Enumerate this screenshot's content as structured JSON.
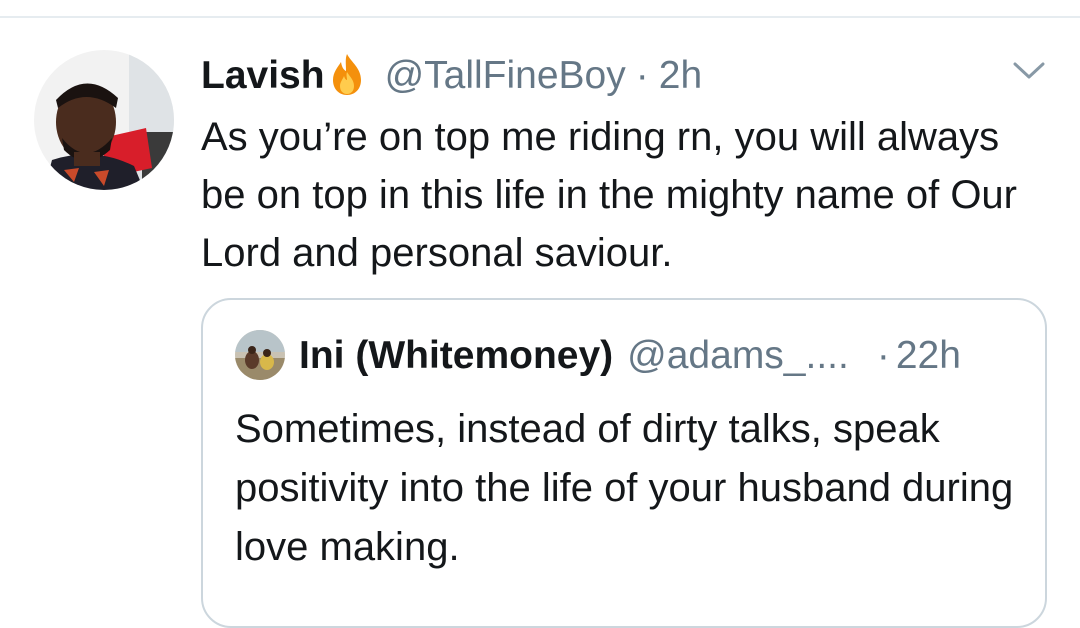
{
  "tweet": {
    "author": {
      "display_name": "Lavish",
      "emoji_icon": "fire-icon",
      "handle": "@TallFineBoy",
      "separator": "·",
      "time": "2h"
    },
    "text": "As you’re on top me riding rn, you will always be on top in this life in the mighty name of Our Lord and personal saviour.",
    "menu_icon": "chevron-down-icon"
  },
  "quoted_tweet": {
    "author": {
      "display_name": "Ini (Whitemoney)",
      "handle": "@adams_....",
      "separator": "·",
      "time": "22h"
    },
    "text": "Sometimes, instead of dirty talks, speak positivity into the life of your husband during love making."
  },
  "colors": {
    "text_primary": "#14171a",
    "text_secondary": "#657786",
    "border": "#ccd6dd",
    "divider": "#e6ecf0"
  }
}
